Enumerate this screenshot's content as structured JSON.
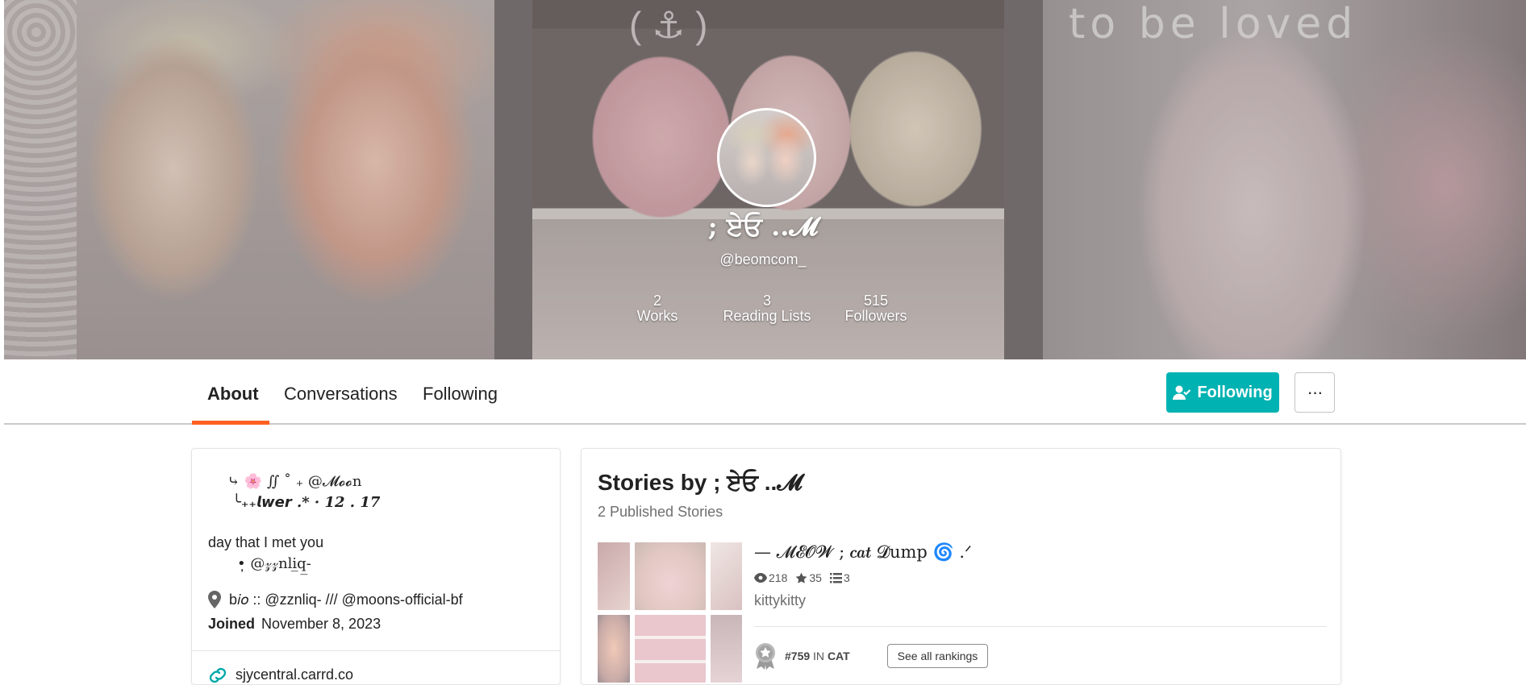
{
  "banner": {
    "overlay_text": "to be loved",
    "jar_text": "( ⚓ )"
  },
  "profile": {
    "display_name": "; ਏਓ ..𝓜",
    "handle": "@beomcom_",
    "stats": {
      "works_count": "2",
      "works_label": "Works",
      "lists_count": "3",
      "lists_label": "Reading Lists",
      "followers_count": "515",
      "followers_label": "Followers"
    }
  },
  "tabs": {
    "about": "About",
    "conversations": "Conversations",
    "following": "Following"
  },
  "actions": {
    "following_button": "Following",
    "more_button": "···"
  },
  "about": {
    "bio_line1": "⤷ 🌸 ∬ ˚ ₊ @𝓜𝓸𝓸n",
    "bio_line2": "╰₊₊𝙡𝙬𝙚𝙧 .* · 12 . 17",
    "bio_line3": "day that I met you",
    "bio_line4": "•̩̩ @𝓏𝓏nli̲q̲-",
    "location": "b𝑖𝑜 :: @zznliq- /// @moons-official-bf",
    "joined_label": "Joined",
    "joined_date": "November 8, 2023",
    "link": "sjycentral.carrd.co"
  },
  "stories": {
    "title": "Stories by ; ਏਓ ..𝓜",
    "count_text": "2 Published Stories",
    "items": [
      {
        "title": "— 𝓜𝓔𝓞𝓦 ; 𝒄𝒂𝒕 𝓓ump 🌀 .ᐟ",
        "reads": "218",
        "votes": "35",
        "parts": "3",
        "description": "kittykitty",
        "rank_number": "#759",
        "rank_in": "IN",
        "rank_tag": "CAT",
        "rankings_button": "See all rankings"
      }
    ]
  },
  "colors": {
    "accent_teal": "#00b2b2",
    "tab_underline": "#ff6122"
  }
}
